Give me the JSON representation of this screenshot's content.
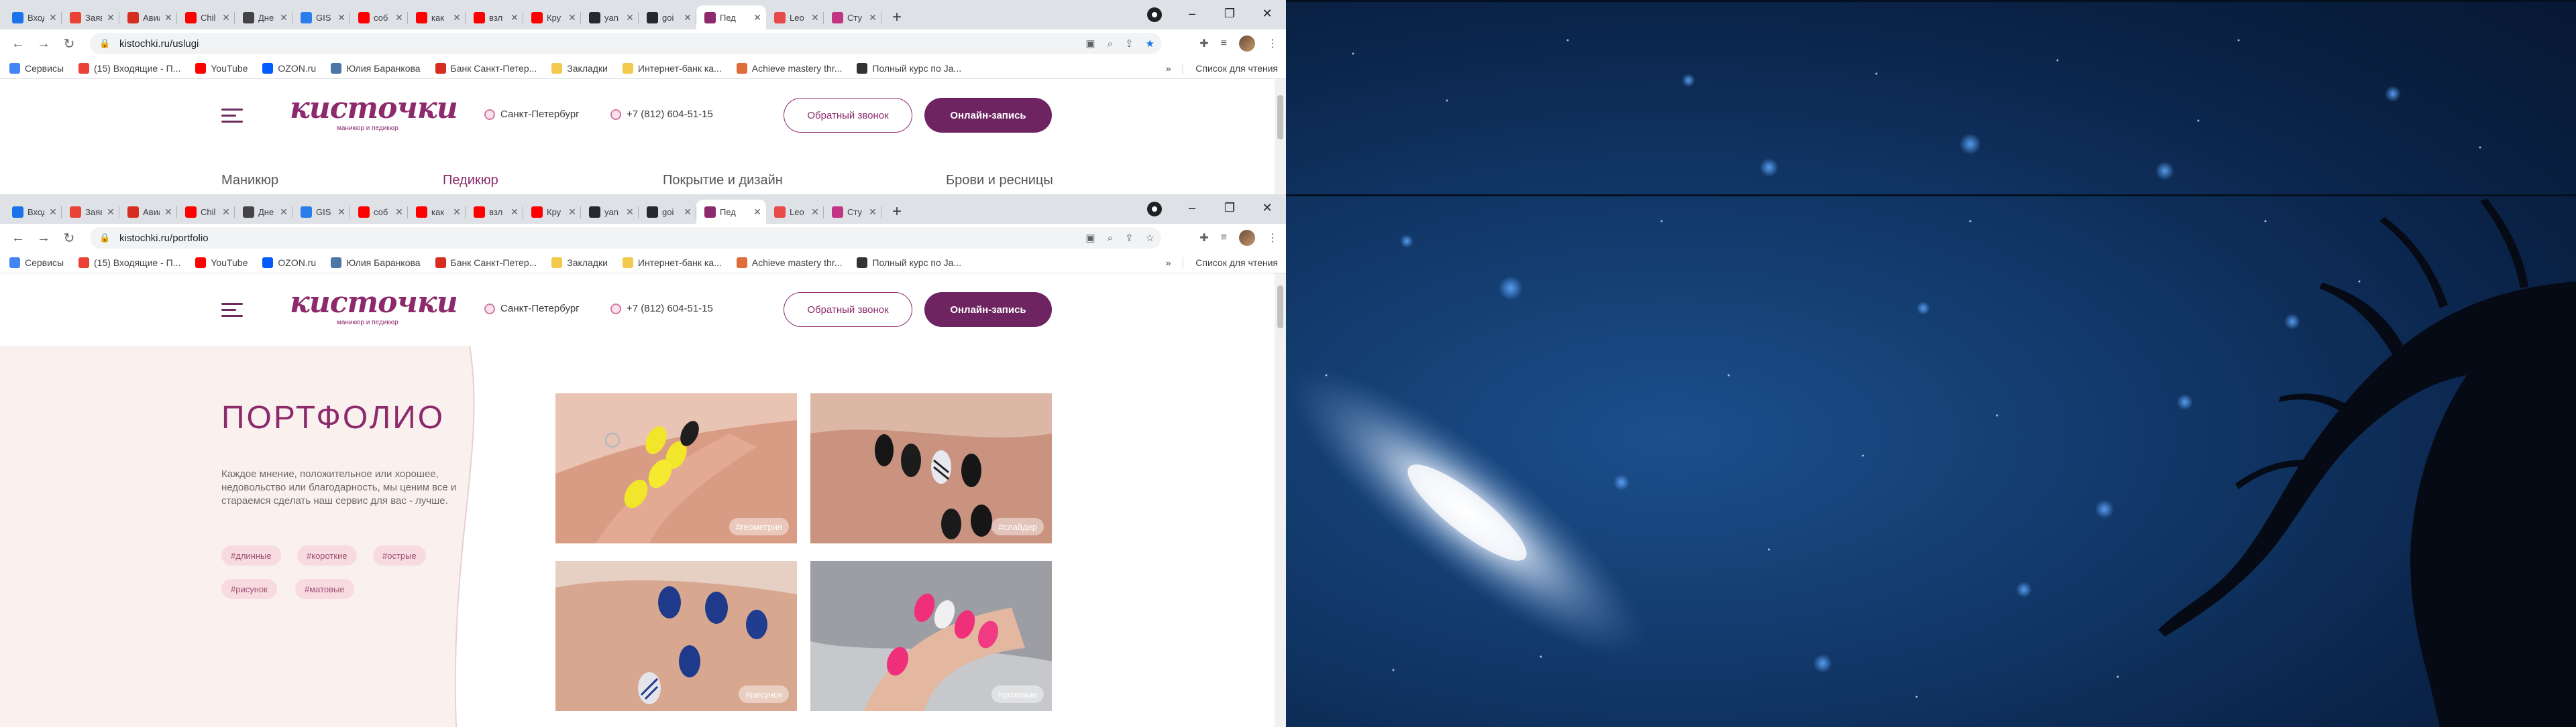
{
  "browser": {
    "tabs": [
      {
        "title": "Вход",
        "fav": "mail-icon",
        "color": "#1a73e8"
      },
      {
        "title": "Заявки",
        "fav": "google-icon",
        "color": "#ea4335"
      },
      {
        "title": "Авиа",
        "fav": "r-icon",
        "color": "#d62d20"
      },
      {
        "title": "Chil",
        "fav": "youtube-icon",
        "color": "#ff0000"
      },
      {
        "title": "Дне",
        "fav": "notebook-icon",
        "color": "#444444"
      },
      {
        "title": "GIS",
        "fav": "drop-icon",
        "color": "#2b7de9"
      },
      {
        "title": "соб",
        "fav": "youtube-icon",
        "color": "#ff0000"
      },
      {
        "title": "как",
        "fav": "youtube-icon",
        "color": "#ff0000"
      },
      {
        "title": "взл",
        "fav": "youtube-icon",
        "color": "#ff0000"
      },
      {
        "title": "Кру",
        "fav": "youtube-icon",
        "color": "#ff0000"
      },
      {
        "title": "yan",
        "fav": "github-icon",
        "color": "#24292e"
      },
      {
        "title": "goi",
        "fav": "github-icon",
        "color": "#24292e"
      },
      {
        "title": "Пед",
        "fav": "kistochki-icon",
        "color": "#8c2a6c"
      },
      {
        "title": "Leo",
        "fav": "leo-icon",
        "color": "#e84a4a"
      },
      {
        "title": "Сту",
        "fav": "instagram-icon",
        "color": "#c13584"
      }
    ],
    "active_tab_index_1": 12,
    "active_tab_index_2": 12,
    "url_1": "kistochki.ru/uslugi",
    "url_2": "kistochki.ru/portfolio",
    "bookmarks": [
      {
        "label": "Сервисы",
        "color": "#4285f4"
      },
      {
        "label": "(15) Входящие - П...",
        "color": "#ea4335"
      },
      {
        "label": "YouTube",
        "color": "#ff0000"
      },
      {
        "label": "OZON.ru",
        "color": "#005bff"
      },
      {
        "label": "Юлия Баранкова",
        "color": "#4a76a8"
      },
      {
        "label": "Банк Санкт-Петер...",
        "color": "#d62d20"
      },
      {
        "label": "Закладки",
        "color": "#f2c94c"
      },
      {
        "label": "Интернет-банк ка...",
        "color": "#f2c94c"
      },
      {
        "label": "Achieve mastery thr...",
        "color": "#e06c3a"
      },
      {
        "label": "Полный курс по Ja...",
        "color": "#333333"
      }
    ],
    "bookmarks_more": "»",
    "reading_list": "Список для чтения"
  },
  "site": {
    "logo": "кисточки",
    "logo_sub": "маникюр и педикюр",
    "city": "Санкт-Петербург",
    "phone": "+7 (812) 604-51-15",
    "callback_button": "Обратный звонок",
    "booking_button": "Онлайн-запись",
    "service_tabs": [
      "Маникюр",
      "Педикюр",
      "Покрытие и дизайн",
      "Брови и ресницы"
    ],
    "active_service_tab": "Педикюр"
  },
  "portfolio": {
    "title": "ПОРТФОЛИО",
    "description": "Каждое мнение, положительное или хорошее, недовольство или благодарность, мы ценим все и стараемся сделать наш сервис для вас - лучше.",
    "filters": [
      "#длинные",
      "#короткие",
      "#острые",
      "#рисунок",
      "#матовые"
    ],
    "photos": [
      {
        "tag": "#геометрия",
        "alt": "yellow-nails-photo"
      },
      {
        "tag": "#слайдер",
        "alt": "black-nails-photo"
      },
      {
        "tag": "#рисунок",
        "alt": "blue-nails-photo"
      },
      {
        "tag": "#розовые",
        "alt": "pink-nails-photo"
      }
    ]
  },
  "colors": {
    "brand": "#8c2a6c",
    "brand_dark": "#6d2460",
    "chip_bg": "#f7dbe0",
    "panel_bg": "#faf0ee"
  }
}
